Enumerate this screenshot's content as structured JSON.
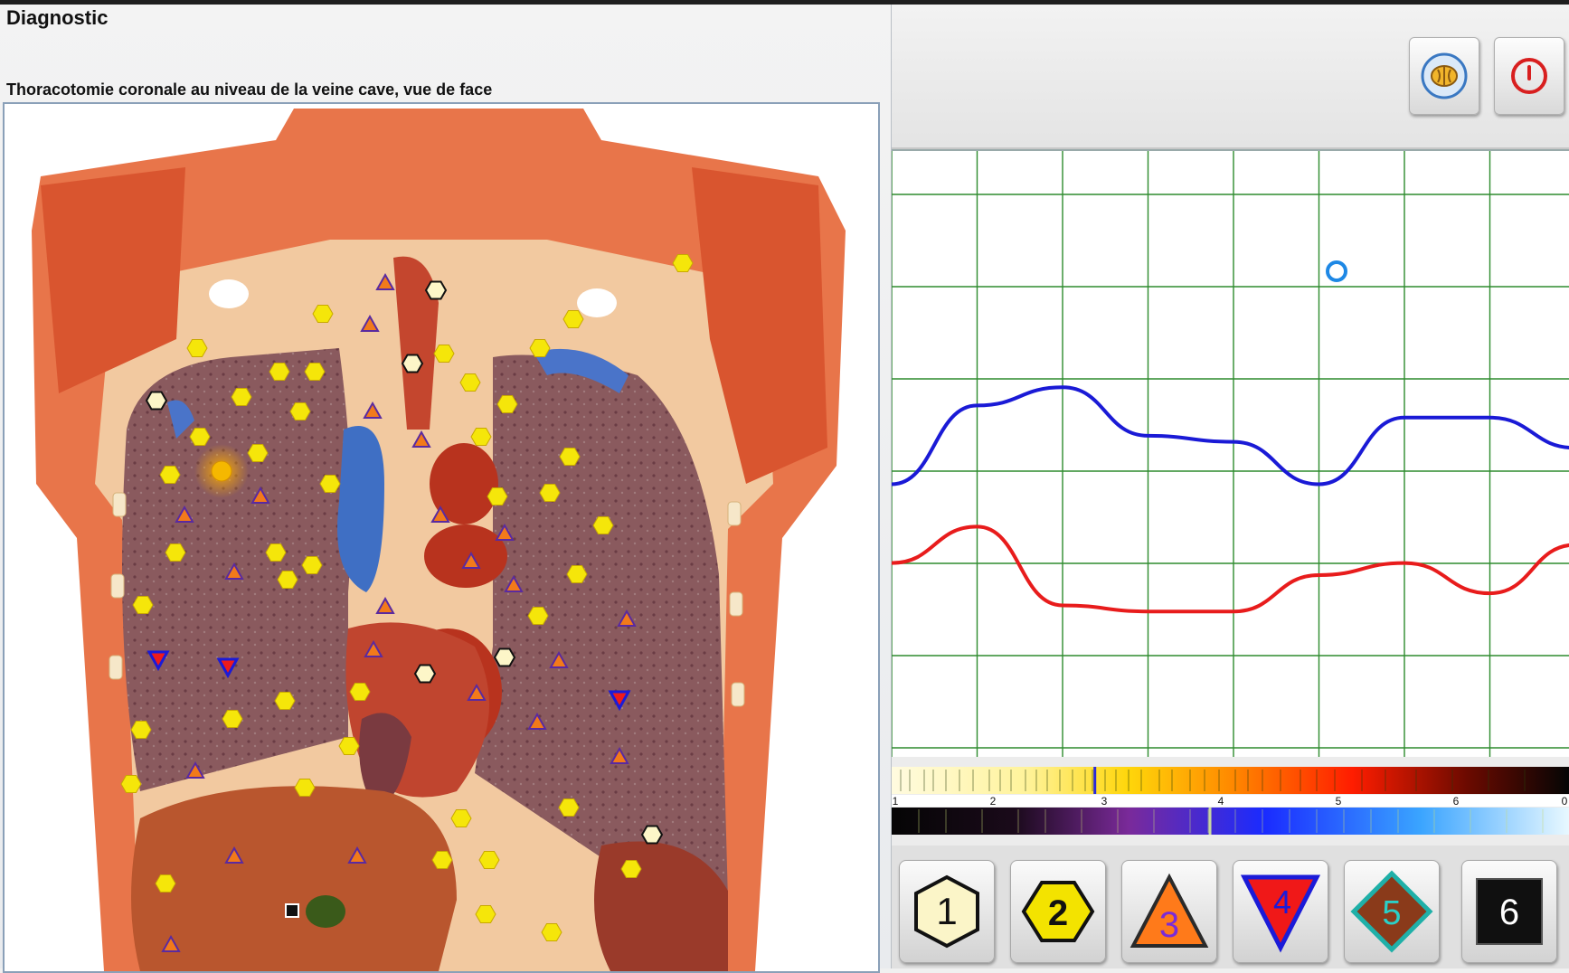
{
  "window": {
    "title": "Diagnostic",
    "subtitle": "Thoracotomie coronale au niveau de la veine cave, vue de face"
  },
  "toolbar": {
    "buttons": [
      {
        "icon": "brain-scan-icon"
      },
      {
        "icon": "power-icon"
      }
    ]
  },
  "graph": {
    "grid_color": "#2e8b2e",
    "cursor_color": "#1e88e5",
    "series": [
      {
        "color": "#1a1ad6",
        "values": [
          0.45,
          0.58,
          0.61,
          0.53,
          0.52,
          0.45,
          0.56,
          0.56,
          0.51
        ]
      },
      {
        "color": "#e81c1c",
        "values": [
          0.32,
          0.38,
          0.25,
          0.24,
          0.24,
          0.3,
          0.32,
          0.27,
          0.35
        ]
      }
    ]
  },
  "spectrum": {
    "scale_labels": [
      "1",
      "2",
      "3",
      "4",
      "5",
      "6",
      "0"
    ],
    "warm_marker": 0.3,
    "cool_marker": 0.47
  },
  "legend": {
    "labels": [
      "1",
      "2",
      "3",
      "4",
      "5",
      "6"
    ]
  }
}
